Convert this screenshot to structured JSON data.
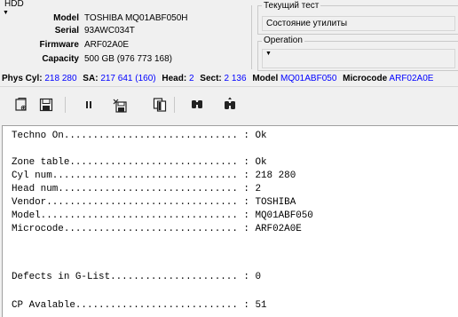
{
  "hdd": {
    "title": "HDD",
    "rows": [
      {
        "key": "Model",
        "value": "TOSHIBA MQ01ABF050H"
      },
      {
        "key": "Serial",
        "value": "93AWC034T"
      },
      {
        "key": "Firmware",
        "value": "ARF02A0E"
      },
      {
        "key": "Capacity",
        "value": "500 GB (976 773 168)"
      }
    ]
  },
  "current_test": {
    "title": "Текущий тест",
    "value": "Состояние утилиты"
  },
  "operation": {
    "title": "Operation",
    "value": ""
  },
  "status": {
    "phys_cyl_label": "Phys Cyl:",
    "phys_cyl_value": "218 280",
    "sa_label": "SA:",
    "sa_value": "217 641 (160)",
    "head_label": "Head:",
    "head_value": "2",
    "sect_label": "Sect:",
    "sect_value": "2 136",
    "model_label": "Model",
    "model_value": "MQ01ABF050",
    "microcode_label": "Microcode",
    "microcode_value": "ARF02A0E"
  },
  "toolbar": {
    "buttons": [
      {
        "icon": "open-icon"
      },
      {
        "icon": "save-icon"
      },
      {
        "icon": "pause-icon"
      },
      {
        "icon": "clear-save-icon"
      },
      {
        "icon": "copy-icon"
      },
      {
        "icon": "find-icon"
      },
      {
        "icon": "find-next-icon"
      }
    ]
  },
  "log": {
    "lines": [
      "Techno On.............................. : Ok",
      "",
      "Zone table............................. : Ok",
      "Cyl num................................ : 218 280",
      "Head num............................... : 2",
      "Vendor................................. : TOSHIBA",
      "Model.................................. : MQ01ABF050",
      "Microcode.............................. : ARF02A0E",
      "",
      "",
      "",
      "Defects in G-List...................... : 0",
      "",
      "CP Avalable............................ : 51"
    ]
  }
}
